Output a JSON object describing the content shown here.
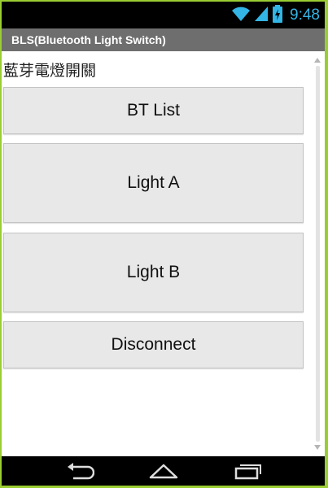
{
  "status_bar": {
    "time": "9:48",
    "icons": [
      "wifi-icon",
      "signal-icon",
      "battery-charging-icon"
    ],
    "accent_color": "#33B5E5"
  },
  "title_bar": {
    "title": "BLS(Bluetooth Light Switch)"
  },
  "main": {
    "heading": "藍芽電燈開關",
    "buttons": [
      {
        "label": "BT List"
      },
      {
        "label": "Light A"
      },
      {
        "label": "Light B"
      },
      {
        "label": "Disconnect"
      }
    ]
  },
  "nav_bar": {
    "icons": [
      "back-icon",
      "home-icon",
      "recent-apps-icon"
    ]
  },
  "colors": {
    "frame_border": "#9ACD32",
    "title_bar_bg": "#6E6E6E",
    "button_bg": "#E8E8E8"
  }
}
